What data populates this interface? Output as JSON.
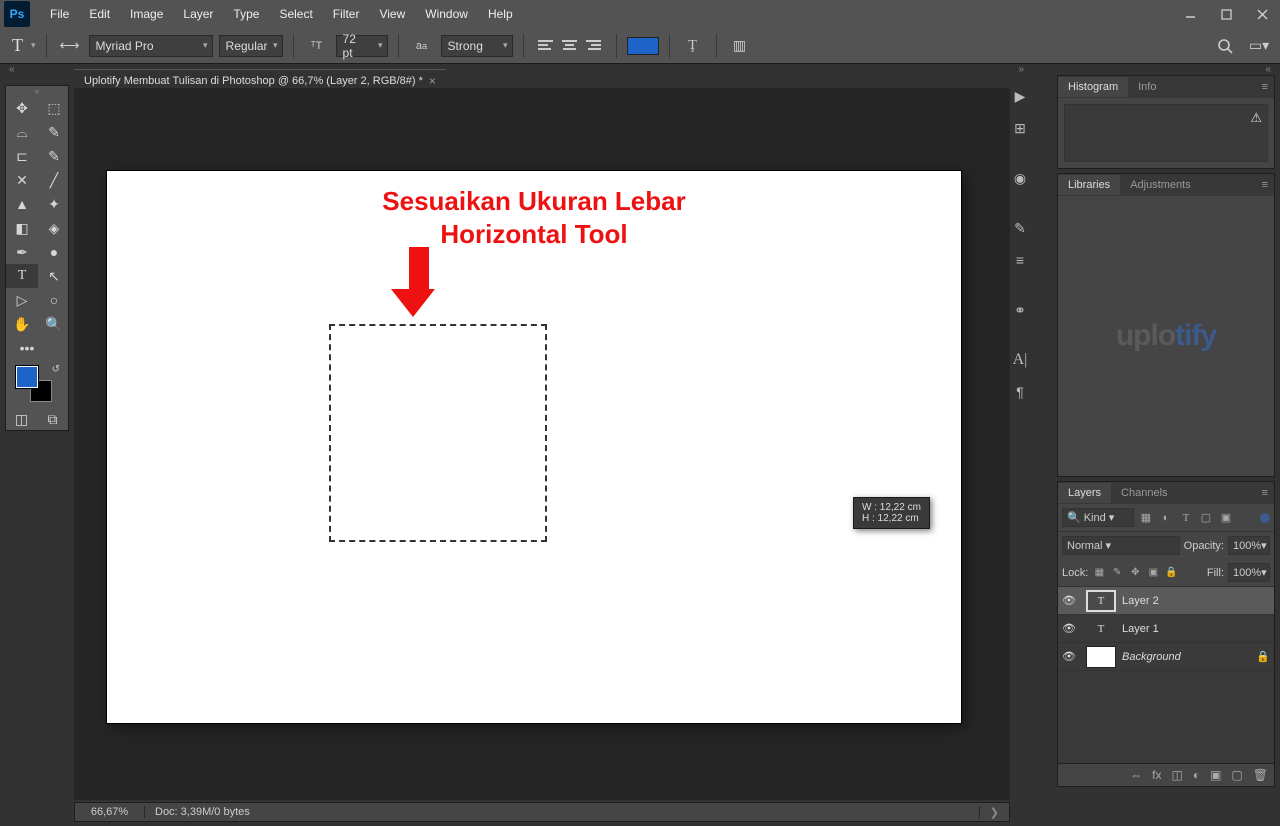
{
  "menu": [
    "File",
    "Edit",
    "Image",
    "Layer",
    "Type",
    "Select",
    "Filter",
    "View",
    "Window",
    "Help"
  ],
  "opt": {
    "font": "Myriad Pro",
    "fontStyle": "Regular",
    "fontSize": "72 pt",
    "aa": "Strong"
  },
  "doc": {
    "tab": "Uplotify Membuat Tulisan di Photoshop @ 66,7% (Layer 2, RGB/8#) *"
  },
  "canvas": {
    "headline1": "Sesuaikan Ukuran Lebar",
    "headline2": "Horizontal Tool",
    "tipW": "W :   12,22 cm",
    "tipH": "H :   12,22 cm"
  },
  "watermark": {
    "a": "uplo",
    "b": "tify"
  },
  "panel": {
    "histogram": "Histogram",
    "info": "Info",
    "libraries": "Libraries",
    "adjustments": "Adjustments",
    "layers": "Layers",
    "channels": "Channels",
    "kind": "Kind",
    "normal": "Normal",
    "opacityL": "Opacity:",
    "opacityV": "100%",
    "lockL": "Lock:",
    "fillL": "Fill:",
    "fillV": "100%",
    "l2": "Layer 2",
    "l1": "Layer 1",
    "bg": "Background"
  },
  "status": {
    "zoom": "66,67%",
    "doc": "Doc: 3,39M/0 bytes"
  }
}
